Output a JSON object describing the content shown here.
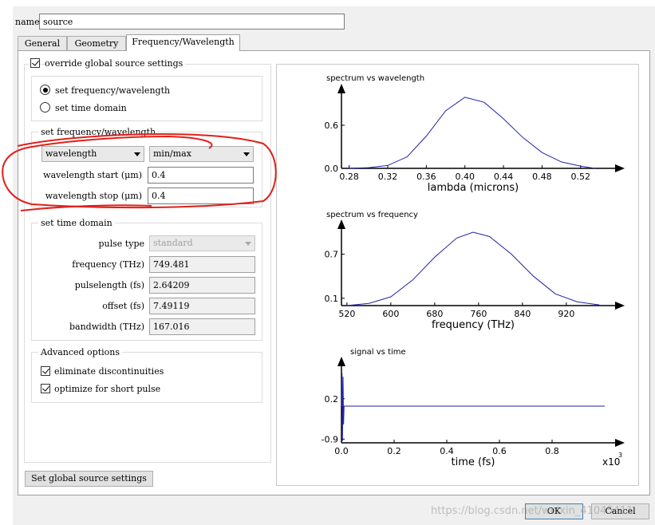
{
  "name_field": {
    "label": "name",
    "value": "source"
  },
  "tabs": [
    {
      "label": "General"
    },
    {
      "label": "Geometry"
    },
    {
      "label": "Frequency/Wavelength"
    }
  ],
  "override": {
    "label": "override global source settings",
    "checked": true
  },
  "mode": {
    "options": [
      {
        "label": "set frequency/wavelength",
        "selected": true
      },
      {
        "label": "set time domain",
        "selected": false
      }
    ]
  },
  "freq_group": {
    "title": "set frequency/wavelength",
    "type_select": "wavelength",
    "range_select": "min/max",
    "start_label": "wavelength start (μm)",
    "start_value": "0.4",
    "stop_label": "wavelength stop (μm)",
    "stop_value": "0.4"
  },
  "time_group": {
    "title": "set time domain",
    "pulse_type_label": "pulse type",
    "pulse_type_value": "standard",
    "frequency_label": "frequency (THz)",
    "frequency_value": "749.481",
    "pulselength_label": "pulselength (fs)",
    "pulselength_value": "2.64209",
    "offset_label": "offset (fs)",
    "offset_value": "7.49119",
    "bandwidth_label": "bandwidth (THz)",
    "bandwidth_value": "167.016"
  },
  "advanced": {
    "title": "Advanced options",
    "eliminate_label": "eliminate discontinuities",
    "eliminate_checked": true,
    "optimize_label": "optimize for short pulse",
    "optimize_checked": true
  },
  "global_button": "Set global source settings",
  "ok_button": "OK",
  "cancel_button": "Cancel",
  "watermark": "https://blog.csdn.net/weixin_41045411",
  "annotation_color": "#e0201a",
  "chart_data": [
    {
      "type": "line",
      "title": "spectrum vs wavelength",
      "xlabel": "lambda (microns)",
      "ylabel": "",
      "xlim": [
        0.272,
        0.545
      ],
      "ylim": [
        0.0,
        1.0
      ],
      "xticks": [
        0.28,
        0.32,
        0.36,
        0.4,
        0.44,
        0.48,
        0.52
      ],
      "xtick_labels": [
        "0.28",
        "0.32",
        "0.36",
        "0.40",
        "0.44",
        "0.48",
        "0.52"
      ],
      "yticks": [
        0.0,
        0.6
      ],
      "ytick_labels": [
        "0.0",
        "0.6"
      ],
      "x": [
        0.28,
        0.3,
        0.32,
        0.34,
        0.36,
        0.38,
        0.4,
        0.42,
        0.44,
        0.46,
        0.48,
        0.5,
        0.52,
        0.535
      ],
      "y": [
        0.0,
        0.01,
        0.04,
        0.16,
        0.45,
        0.8,
        0.99,
        0.92,
        0.69,
        0.43,
        0.22,
        0.09,
        0.03,
        0.0
      ],
      "color": "#2222a8"
    },
    {
      "type": "line",
      "title": "spectrum vs frequency",
      "xlabel": "frequency (THz)",
      "ylabel": "",
      "xlim": [
        510,
        990
      ],
      "ylim": [
        0.0,
        1.0
      ],
      "xticks": [
        520,
        600,
        680,
        760,
        840,
        920
      ],
      "xtick_labels": [
        "520",
        "600",
        "680",
        "760",
        "840",
        "920"
      ],
      "yticks": [
        0.1,
        0.7
      ],
      "ytick_labels": [
        "0.1",
        "0.7"
      ],
      "x": [
        520,
        560,
        600,
        640,
        680,
        720,
        750,
        780,
        820,
        860,
        900,
        940,
        980
      ],
      "y": [
        0.0,
        0.03,
        0.12,
        0.35,
        0.66,
        0.92,
        1.0,
        0.94,
        0.7,
        0.4,
        0.16,
        0.05,
        0.01
      ],
      "color": "#2222a8"
    },
    {
      "type": "line",
      "title": "signal vs time",
      "xlabel": "time (fs)",
      "ylabel": "",
      "x_multiplier": "x10",
      "x_multiplier_exp": "3",
      "xlim": [
        0.0,
        1.0
      ],
      "ylim": [
        -1.0,
        1.0
      ],
      "xticks": [
        0.0,
        0.2,
        0.4,
        0.6,
        0.8
      ],
      "xtick_labels": [
        "0.0",
        "0.2",
        "0.4",
        "0.6",
        "0.8"
      ],
      "yticks": [
        0.2,
        -0.9
      ],
      "ytick_labels": [
        "0.2",
        "-0.9"
      ],
      "x": [
        0.0,
        0.002,
        0.004,
        0.006,
        0.008,
        0.01,
        1.0
      ],
      "y": [
        0.0,
        0.9,
        -0.95,
        0.8,
        -0.5,
        0.0,
        0.0
      ],
      "color": "#2222a8"
    }
  ]
}
